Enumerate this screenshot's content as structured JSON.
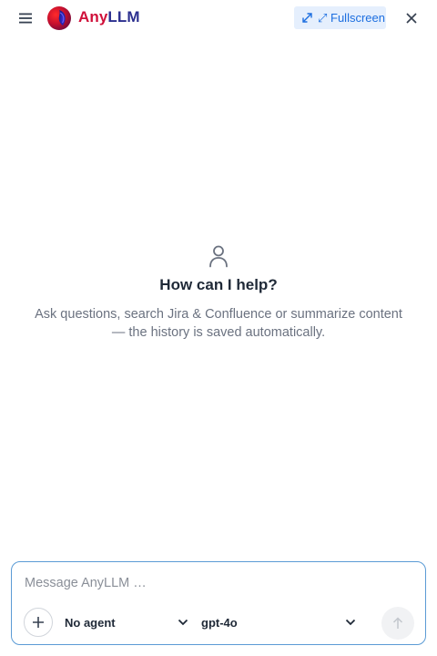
{
  "header": {
    "brand_part_a": "Any",
    "brand_part_b": "LLM",
    "fullscreen_label": "⤢ Fullscreen",
    "icons": {
      "menu": "hamburger-icon",
      "logo": "anyllm-logo",
      "fullscreen": "expand-arrows-icon",
      "close": "close-icon"
    }
  },
  "empty_state": {
    "icon": "person-icon",
    "title": "How can I help?",
    "subtitle": "Ask questions, search Jira & Confluence or summarize content — the history is saved automatically."
  },
  "composer": {
    "input_value": "",
    "input_placeholder": "Message AnyLLM …",
    "attach_icon": "plus-icon",
    "agent_select": {
      "selected": "No agent",
      "icon": "chevron-down-icon"
    },
    "model_select": {
      "selected": "gpt-4o",
      "icon": "chevron-down-icon"
    },
    "send_icon": "arrow-up-icon"
  },
  "colors": {
    "brand_red": "#d0103a",
    "brand_navy": "#2b2f8f",
    "accent_blue": "#1d6fe0",
    "fullscreen_bg": "#e5effd",
    "composer_border": "#5b9bd5",
    "muted_text": "#6b7280"
  }
}
